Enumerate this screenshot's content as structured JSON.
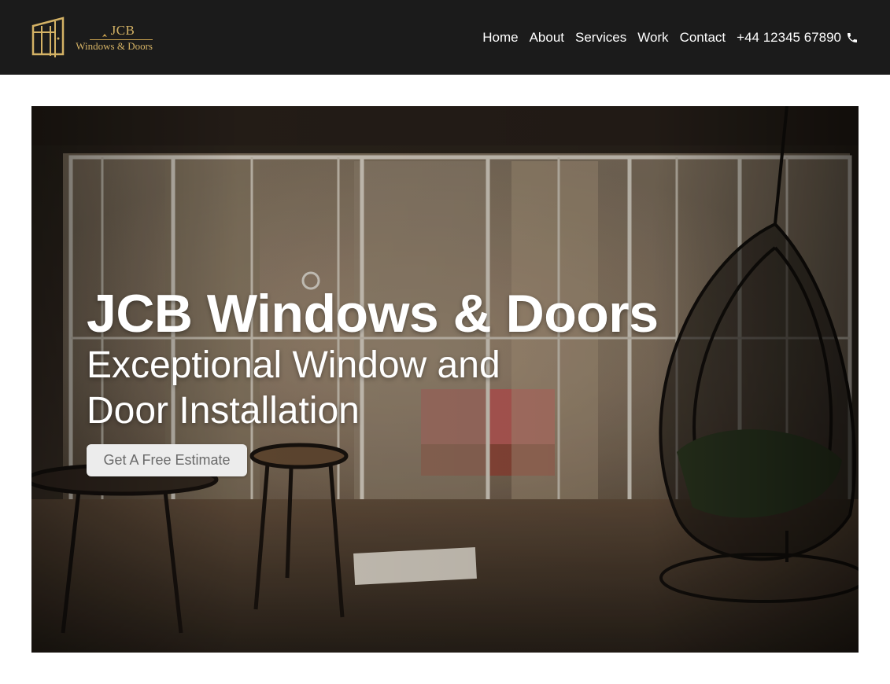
{
  "brand": {
    "name": "JCB",
    "tagline": "Windows & Doors",
    "logo_icon": "window-frame-logo",
    "color": "#d4b265"
  },
  "nav": {
    "items": [
      {
        "label": "Home"
      },
      {
        "label": "About"
      },
      {
        "label": "Services"
      },
      {
        "label": "Work"
      },
      {
        "label": "Contact"
      }
    ],
    "phone": "+44 12345 67890",
    "phone_icon": "phone-icon"
  },
  "hero": {
    "title": "JCB Windows & Doors",
    "subtitle": "Exceptional Window and Door Installation",
    "cta_label": "Get A Free Estimate",
    "image_subject": "interior with glass sliding doors and hanging egg chair"
  },
  "colors": {
    "header_bg": "#1b1b1b",
    "nav_text": "#ffffff",
    "cta_bg": "#ececec",
    "cta_text": "#6a6a6a"
  }
}
